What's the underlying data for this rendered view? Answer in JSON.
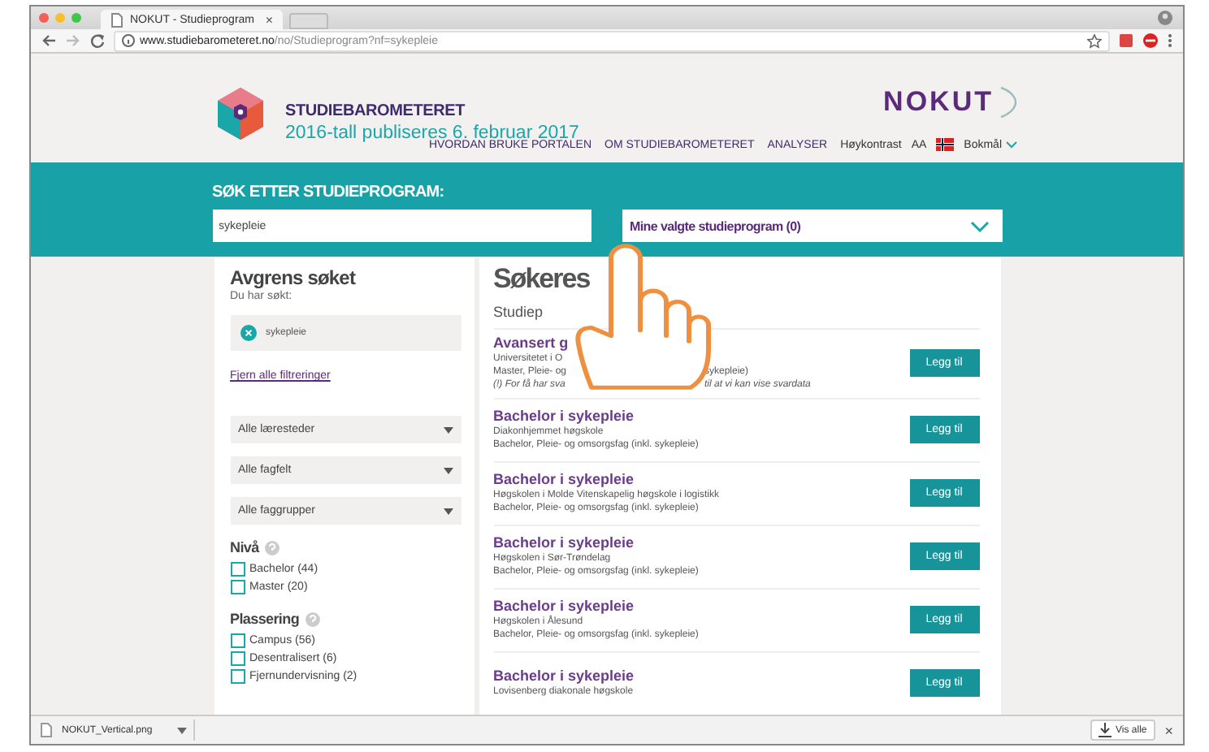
{
  "browser": {
    "tabs": [
      {
        "title": "NOKUT - Studieprogram",
        "close": "×",
        "selected": true
      }
    ],
    "address": {
      "host": "www.studiebarometeret.no",
      "path": "/no/Studieprogram?nf=sykepleie"
    }
  },
  "header": {
    "brand": "STUDIEBAROMETERET",
    "tagline": "2016-tall publiseres 6. februar 2017",
    "nav": [
      "HVORDAN BRUKE PORTALEN",
      "OM STUDIEBAROMETERET",
      "ANALYSER"
    ],
    "contrast": "Høykontrast",
    "font_size": "AA",
    "language": "Bokmål",
    "org_logo": "NOKUT"
  },
  "search": {
    "heading": "SØK ETTER STUDIEPROGRAM:",
    "value": "sykepleie",
    "selected_programs": "Mine valgte studieprogram (0)"
  },
  "filters": {
    "title": "Avgrens søket",
    "searched_label": "Du har søkt:",
    "chips": [
      "sykepleie"
    ],
    "clear_link": "Fjern alle filtreringer",
    "dropdowns": [
      "Alle læresteder",
      "Alle fagfelt",
      "Alle faggrupper"
    ],
    "groups": [
      {
        "title": "Nivå",
        "options": [
          {
            "label": "Bachelor (44)",
            "checked": false
          },
          {
            "label": "Master (20)",
            "checked": false
          }
        ]
      },
      {
        "title": "Plassering",
        "options": [
          {
            "label": "Campus (56)",
            "checked": false
          },
          {
            "label": "Desentralisert (6)",
            "checked": false
          },
          {
            "label": "Fjernundervisning (2)",
            "checked": false
          }
        ]
      }
    ]
  },
  "results": {
    "heading": "Søkeres",
    "subheading": "Studiep",
    "items": [
      {
        "title": "Avansert g",
        "button": "Legg til",
        "lines": [
          {
            "kind": "info",
            "parts": [
              "Universitetet i O"
            ]
          },
          {
            "kind": "info",
            "parts": [
              "Master, Pleie- og",
              "sykepleie)"
            ]
          },
          {
            "kind": "note",
            "parts": [
              "(!) For få har sva",
              "til at vi kan vise svardata"
            ]
          }
        ]
      },
      {
        "title": "Bachelor i sykepleie",
        "button": "Legg til",
        "lines": [
          {
            "kind": "info",
            "parts": [
              "Diakonhjemmet høgskole"
            ]
          },
          {
            "kind": "info",
            "parts": [
              "Bachelor, Pleie- og omsorgsfag (inkl. sykepleie)"
            ]
          }
        ]
      },
      {
        "title": "Bachelor i sykepleie",
        "button": "Legg til",
        "lines": [
          {
            "kind": "info",
            "parts": [
              "Høgskolen i Molde Vitenskapelig høgskole i logistikk"
            ]
          },
          {
            "kind": "info",
            "parts": [
              "Bachelor, Pleie- og omsorgsfag (inkl. sykepleie)"
            ]
          }
        ]
      },
      {
        "title": "Bachelor i sykepleie",
        "button": "Legg til",
        "lines": [
          {
            "kind": "info",
            "parts": [
              "Høgskolen i Sør-Trøndelag"
            ]
          },
          {
            "kind": "info",
            "parts": [
              "Bachelor, Pleie- og omsorgsfag (inkl. sykepleie)"
            ]
          }
        ]
      },
      {
        "title": "Bachelor i sykepleie",
        "button": "Legg til",
        "lines": [
          {
            "kind": "info",
            "parts": [
              "Høgskolen i Ålesund"
            ]
          },
          {
            "kind": "info",
            "parts": [
              "Bachelor, Pleie- og omsorgsfag (inkl. sykepleie)"
            ]
          }
        ]
      },
      {
        "title": "Bachelor i sykepleie",
        "button": "Legg til",
        "lines": [
          {
            "kind": "info",
            "parts": [
              "Lovisenberg diakonale høgskole"
            ]
          }
        ]
      }
    ]
  },
  "downloads": {
    "file": "NOKUT_Vertical.png",
    "show_all": "Vis alle",
    "close": "×"
  }
}
